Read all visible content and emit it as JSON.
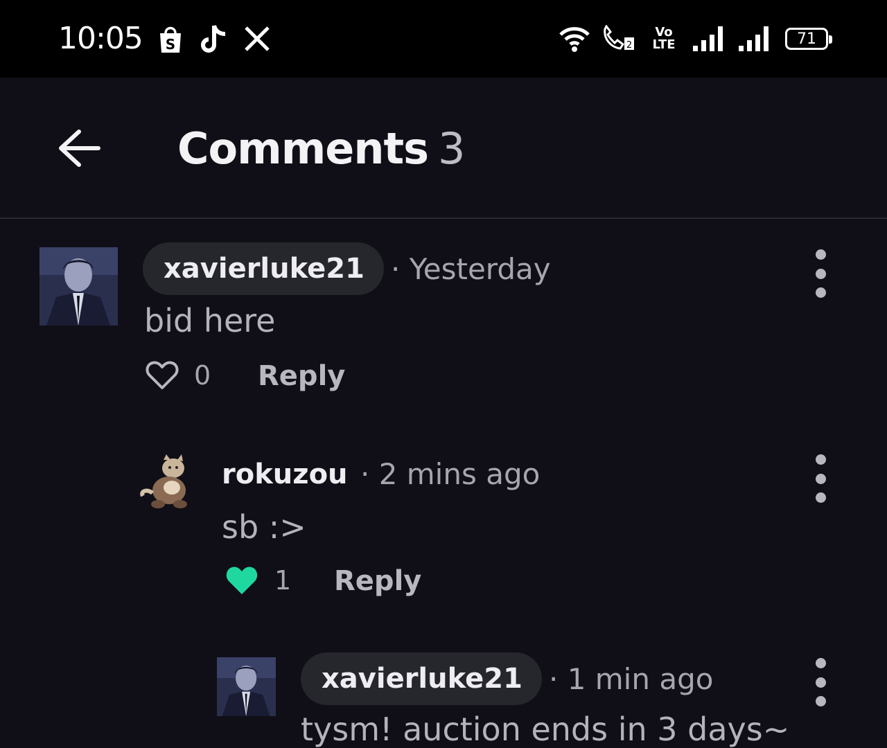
{
  "status_bar": {
    "time": "10:05",
    "notification_icons": [
      "shopee-bag-icon",
      "tiktok-icon",
      "x-icon"
    ],
    "battery": "71",
    "volte_label": "Vo LTE"
  },
  "header": {
    "title": "Comments",
    "count": "3"
  },
  "comments": [
    {
      "username": "xavierluke21",
      "time": "· Yesterday",
      "text": "bid here",
      "likes": "0",
      "liked": false,
      "reply_label": "Reply"
    },
    {
      "username": "rokuzou",
      "time": "· 2 mins ago",
      "text": "sb :>",
      "likes": "1",
      "liked": true,
      "reply_label": "Reply"
    },
    {
      "username": "xavierluke21",
      "time": "· 1 min ago",
      "text": "tysm! auction ends in 3 days~"
    }
  ],
  "colors": {
    "background": "#100f17",
    "liked_heart": "#1fd8a0",
    "pill": "#26262d"
  }
}
